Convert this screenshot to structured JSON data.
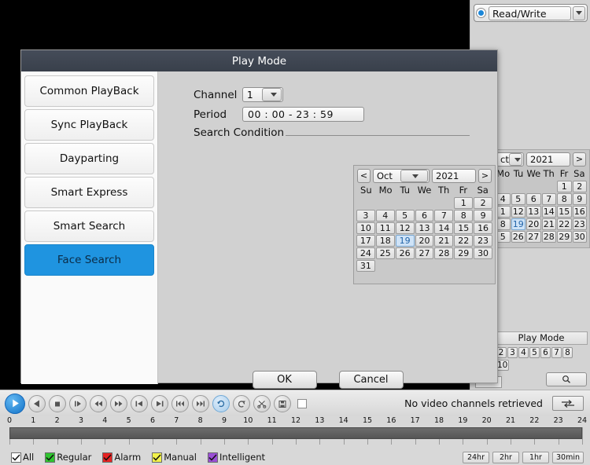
{
  "window": {
    "title": "Play Mode"
  },
  "read_write": {
    "value": "Read/Write",
    "radio_icon": "radio-selected-icon",
    "arrow_icon": "chevron-down-icon"
  },
  "sidebar": {
    "items": [
      {
        "label": "Common PlayBack",
        "active": false
      },
      {
        "label": "Sync PlayBack",
        "active": false
      },
      {
        "label": "Dayparting",
        "active": false
      },
      {
        "label": "Smart Express",
        "active": false
      },
      {
        "label": "Smart Search",
        "active": false
      },
      {
        "label": "Face Search",
        "active": true
      }
    ],
    "active_color": "#1f94e0"
  },
  "form": {
    "channel_label": "Channel",
    "channel_value": "1",
    "period_label": "Period",
    "period_value": "00 : 00     -     23 : 59",
    "search_condition_label": "Search Condition"
  },
  "calendar": {
    "prev_label": "<",
    "next_label": ">",
    "month": "Oct",
    "year": "2021",
    "dow": [
      "Su",
      "Mo",
      "Tu",
      "We",
      "Th",
      "Fr",
      "Sa"
    ],
    "lead_blanks": 5,
    "days": [
      1,
      2,
      3,
      4,
      5,
      6,
      7,
      8,
      9,
      10,
      11,
      12,
      13,
      14,
      15,
      16,
      17,
      18,
      19,
      20,
      21,
      22,
      23,
      24,
      25,
      26,
      27,
      28,
      29,
      30,
      31
    ],
    "selected_day": 19,
    "selected_color": "#cfe3f7"
  },
  "ghost_calendar": {
    "month": "ct",
    "year": "2021",
    "next_label": ">",
    "dow": [
      "Mo",
      "Tu",
      "We",
      "Th",
      "Fr",
      "Sa"
    ],
    "rows": [
      [
        "",
        "",
        "",
        "",
        "1",
        "2"
      ],
      [
        "4",
        "5",
        "6",
        "7",
        "8",
        "9"
      ],
      [
        "1",
        "12",
        "13",
        "14",
        "15",
        "16"
      ],
      [
        "8",
        "19",
        "20",
        "21",
        "22",
        "23"
      ],
      [
        "5",
        "26",
        "27",
        "28",
        "29",
        "30"
      ]
    ],
    "selected": "19"
  },
  "dialog_buttons": {
    "ok": "OK",
    "cancel": "Cancel"
  },
  "play_mode_box": {
    "title": "Play Mode",
    "numbers": [
      "2",
      "3",
      "4",
      "5",
      "6",
      "7",
      "8"
    ],
    "second_row": [
      "10"
    ],
    "search_icon": "magnifier-icon"
  },
  "toolbar": {
    "controls": [
      {
        "name": "play-button",
        "icon": "play-icon",
        "state": "primary"
      },
      {
        "name": "reverse-play-button",
        "icon": "play-reverse-icon",
        "state": "normal"
      },
      {
        "name": "stop-button",
        "icon": "stop-icon",
        "state": "normal"
      },
      {
        "name": "slow-play-button",
        "icon": "slow-play-icon",
        "state": "normal"
      },
      {
        "name": "rewind-button",
        "icon": "rewind-icon",
        "state": "normal"
      },
      {
        "name": "fast-forward-button",
        "icon": "fast-forward-icon",
        "state": "normal"
      },
      {
        "name": "previous-file-button",
        "icon": "skip-previous-icon",
        "state": "normal"
      },
      {
        "name": "next-file-button",
        "icon": "skip-next-icon",
        "state": "normal"
      },
      {
        "name": "previous-frame-button",
        "icon": "step-backward-icon",
        "state": "normal"
      },
      {
        "name": "next-frame-button",
        "icon": "step-forward-icon",
        "state": "normal"
      },
      {
        "name": "loop-button",
        "icon": "loop-icon",
        "state": "active"
      },
      {
        "name": "repeat-button",
        "icon": "repeat-icon",
        "state": "normal"
      },
      {
        "name": "clip-button",
        "icon": "scissors-icon",
        "state": "normal"
      },
      {
        "name": "save-button",
        "icon": "save-icon",
        "state": "normal"
      }
    ],
    "checkbox_checked": false,
    "status_text": "No video channels retrieved",
    "refresh_icon": "sync-arrows-icon"
  },
  "timeline": {
    "hours": [
      0,
      1,
      2,
      3,
      4,
      5,
      6,
      7,
      8,
      9,
      10,
      11,
      12,
      13,
      14,
      15,
      16,
      17,
      18,
      19,
      20,
      21,
      22,
      23,
      24
    ]
  },
  "legend": {
    "items": [
      {
        "label": "All",
        "color": "#ffffff",
        "checked": true
      },
      {
        "label": "Regular",
        "color": "#2fc42f",
        "checked": true
      },
      {
        "label": "Alarm",
        "color": "#e62222",
        "checked": true
      },
      {
        "label": "Manual",
        "color": "#f2f24a",
        "checked": true
      },
      {
        "label": "Intelligent",
        "color": "#9b4fd6",
        "checked": true
      }
    ],
    "zoom_buttons": [
      "24hr",
      "2hr",
      "1hr",
      "30min"
    ]
  }
}
